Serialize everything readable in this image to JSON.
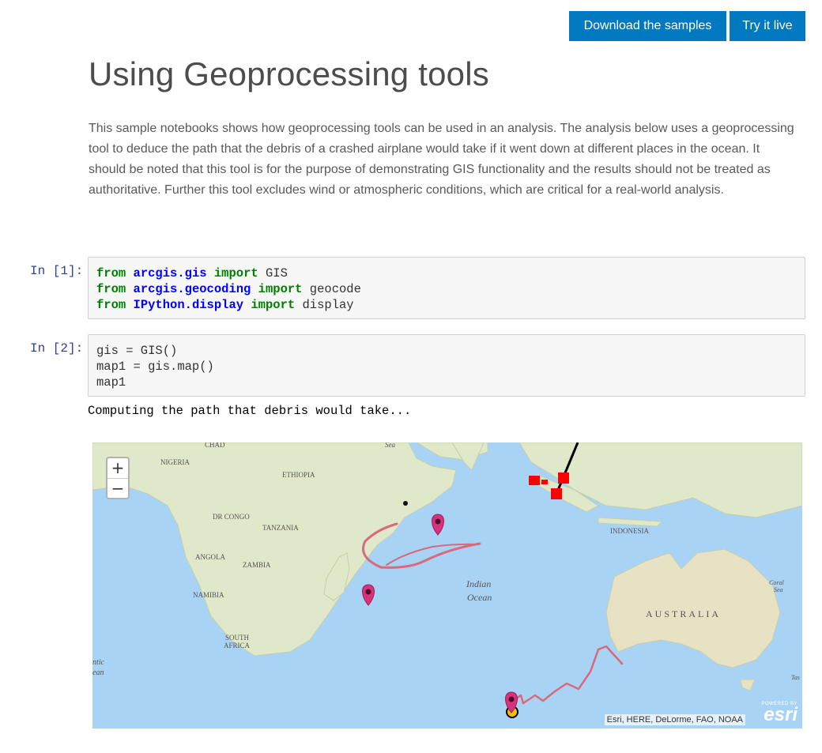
{
  "header": {
    "download_label": "Download the samples",
    "try_label": "Try it live"
  },
  "page": {
    "title": "Using Geoprocessing tools",
    "intro": "This sample notebooks shows how geoprocessing tools can be used in an analysis. The analysis below uses a geoprocessing tool to deduce the path that the debris of a crashed airplane would take if it went down at different places in the ocean. It should be noted that this tool is for the purpose of demonstrating GIS functionality and the results should not be treated as authoritative. Further this tool excludes wind or atmospheric conditions, which are critical for a real-world analysis."
  },
  "cells": [
    {
      "prompt": "In [1]:",
      "lines": [
        [
          {
            "t": "from",
            "c": "kw"
          },
          {
            "t": " "
          },
          {
            "t": "arcgis.gis",
            "c": "mod"
          },
          {
            "t": " "
          },
          {
            "t": "import",
            "c": "kw"
          },
          {
            "t": " GIS"
          }
        ],
        [
          {
            "t": "from",
            "c": "kw"
          },
          {
            "t": " "
          },
          {
            "t": "arcgis.geocoding",
            "c": "mod"
          },
          {
            "t": " "
          },
          {
            "t": "import",
            "c": "kw"
          },
          {
            "t": " geocode"
          }
        ],
        [
          {
            "t": "from",
            "c": "kw"
          },
          {
            "t": " "
          },
          {
            "t": "IPython.display",
            "c": "mod"
          },
          {
            "t": " "
          },
          {
            "t": "import",
            "c": "kw"
          },
          {
            "t": " display"
          }
        ]
      ]
    },
    {
      "prompt": "In [2]:",
      "lines": [
        [
          {
            "t": "gis = GIS()"
          }
        ],
        [
          {
            "t": "map1 = gis.map()"
          }
        ],
        [
          {
            "t": "map1"
          }
        ]
      ]
    }
  ],
  "output_text": "Computing the path that debris would take...",
  "map": {
    "zoom_in": "+",
    "zoom_out": "−",
    "labels": {
      "chad": "CHAD",
      "sea": "Sea",
      "nigeria": "NIGERIA",
      "ethiopia": "ETHIOPIA",
      "drcongo": "DR CONGO",
      "tanzania": "TANZANIA",
      "angola": "ANGOLA",
      "zambia": "ZAMBIA",
      "namibia": "NAMIBIA",
      "south": "SOUTH",
      "africa": "AFRICA",
      "atlantic": "ntic",
      "ocean_left": "ean",
      "indonesia": "INDONESIA",
      "indian": "Indian",
      "ocean": "Ocean",
      "australia": "AUSTRALIA",
      "coral": "Coral",
      "coral_sea": "Sea",
      "tas": "Tas"
    },
    "attribution": "Esri, HERE, DeLorme, FAO, NOAA",
    "esri_powered": "POWERED BY",
    "esri_logo": "esri",
    "colors": {
      "ocean": "#a9d3f5",
      "land": "#dfe8c8",
      "path": "#d86a7c",
      "marker": "#d6337c",
      "box": "#ff0000"
    }
  }
}
